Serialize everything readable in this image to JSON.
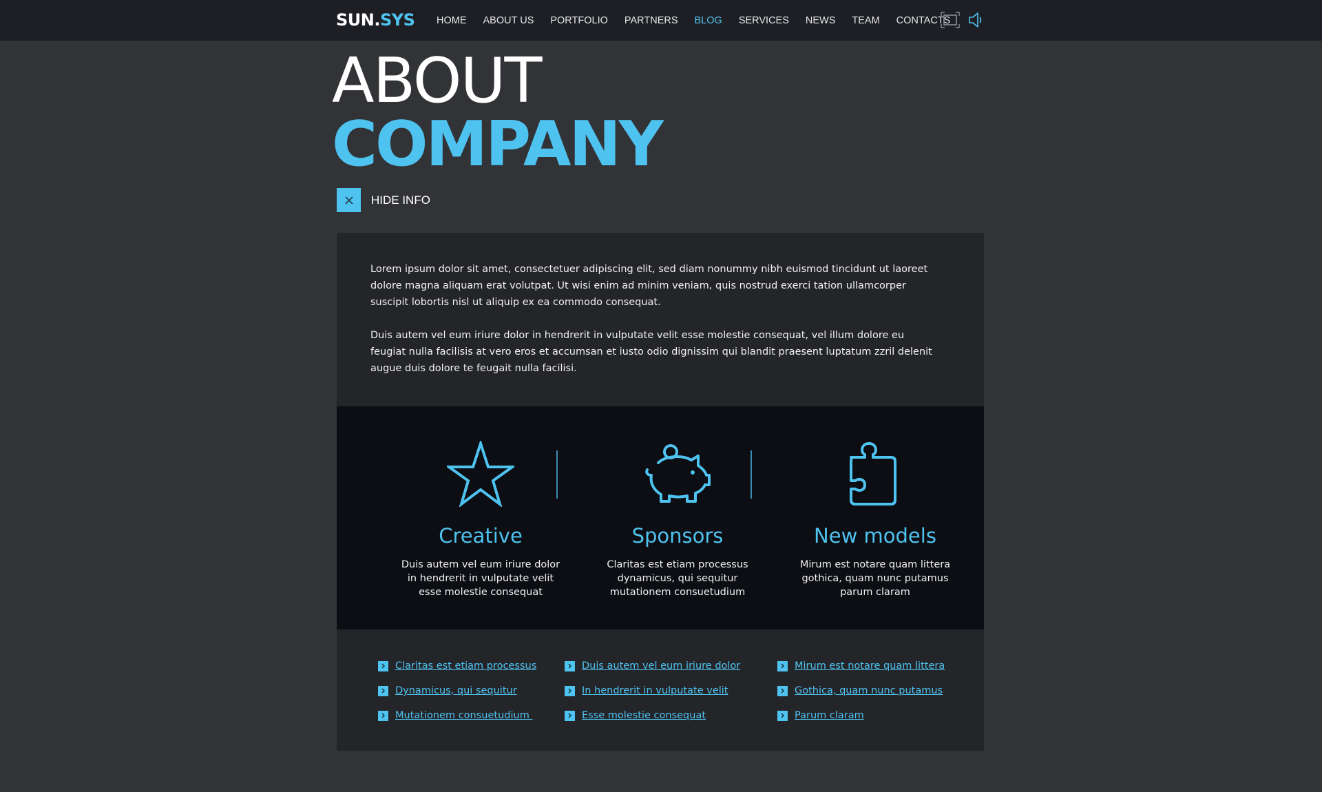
{
  "colors": {
    "accent": "#4fc3f0",
    "background": "#323337",
    "topbar": "#1e1f24",
    "panel": "#242529",
    "features_band": "#0c0e13"
  },
  "header": {
    "logo_part1": "SUN.",
    "logo_part2": "SYS",
    "nav": [
      "HOME",
      "ABOUT US",
      "PORTFOLIO",
      "PARTNERS",
      "BLOG",
      "SERVICES",
      "NEWS",
      "TEAM",
      "CONTACTS"
    ],
    "active_nav": "BLOG",
    "icons": [
      "fullscreen-icon",
      "speaker-icon"
    ]
  },
  "hero": {
    "line1": "ABOUT",
    "line2": "COMPANY",
    "hide_info_label": "HIDE INFO",
    "hide_info_icon": "close-icon"
  },
  "intro": {
    "paragraphs": [
      "Lorem ipsum dolor sit amet, consectetuer adipiscing elit, sed diam nonummy nibh euismod tincidunt ut laoreet dolore magna aliquam erat volutpat. Ut wisi enim ad minim veniam, quis nostrud exerci tation ullamcorper suscipit lobortis nisl ut aliquip ex ea commodo consequat.",
      "Duis autem vel eum iriure dolor in hendrerit in vulputate velit esse molestie consequat, vel illum dolore eu feugiat nulla facilisis at vero eros et accumsan et iusto odio dignissim qui blandit praesent luptatum zzril delenit augue duis dolore te feugait nulla facilisi."
    ]
  },
  "features": [
    {
      "icon": "star-icon",
      "title": "Creative",
      "desc": "Duis autem vel eum iriure dolor in hendrerit in vulputate velit esse molestie consequat"
    },
    {
      "icon": "piggy-bank-icon",
      "title": "Sponsors",
      "desc": "Claritas est etiam processus dynamicus, qui sequitur mutationem consuetudium"
    },
    {
      "icon": "puzzle-icon",
      "title": "New models",
      "desc": "Mirum est notare quam littera gothica, quam nunc putamus parum claram"
    }
  ],
  "links": [
    [
      "Claritas est etiam processus",
      "Dynamicus, qui sequitur",
      "Mutationem consuetudium "
    ],
    [
      "Duis autem vel eum iriure dolor",
      "In hendrerit in vulputate velit",
      "Esse molestie consequat"
    ],
    [
      "Mirum est notare quam littera",
      "Gothica, quam nunc putamus",
      "Parum claram"
    ]
  ]
}
